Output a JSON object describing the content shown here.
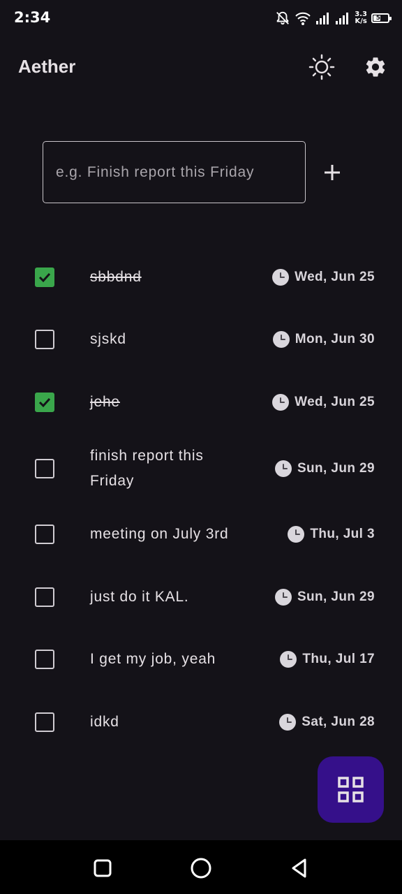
{
  "status_bar": {
    "time": "2:34",
    "network_speed_value": "3.3",
    "network_speed_unit": "K/s",
    "battery_level": "56",
    "icons": [
      "notifications-off-icon",
      "wifi-icon",
      "signal-icon",
      "signal-icon"
    ]
  },
  "app_bar": {
    "title": "Aether",
    "theme_icon": "sun-icon",
    "settings_icon": "gear-icon"
  },
  "new_task": {
    "placeholder": "e.g. Finish report this Friday",
    "value": "",
    "add_icon": "plus-icon"
  },
  "tasks": [
    {
      "title": "sbbdnd",
      "done": true,
      "due": "Wed, Jun 25"
    },
    {
      "title": "sjskd",
      "done": false,
      "due": "Mon, Jun 30"
    },
    {
      "title": "jehe",
      "done": true,
      "due": "Wed, Jun 25"
    },
    {
      "title": "finish report this Friday",
      "done": false,
      "due": "Sun, Jun 29"
    },
    {
      "title": "meeting on July 3rd",
      "done": false,
      "due": "Thu, Jul 3"
    },
    {
      "title": "just do it KAL.",
      "done": false,
      "due": "Sun, Jun 29"
    },
    {
      "title": "I get my job, yeah",
      "done": false,
      "due": "Thu, Jul 17"
    },
    {
      "title": "idkd",
      "done": false,
      "due": "Sat, Jun 28"
    }
  ],
  "fab": {
    "icon": "grid-view-icon"
  },
  "nav_bar": {
    "icons": [
      "recents-square-icon",
      "home-circle-icon",
      "back-triangle-icon"
    ]
  },
  "colors": {
    "background": "#141218",
    "checked": "#3aa64b",
    "fab": "#35108a"
  }
}
